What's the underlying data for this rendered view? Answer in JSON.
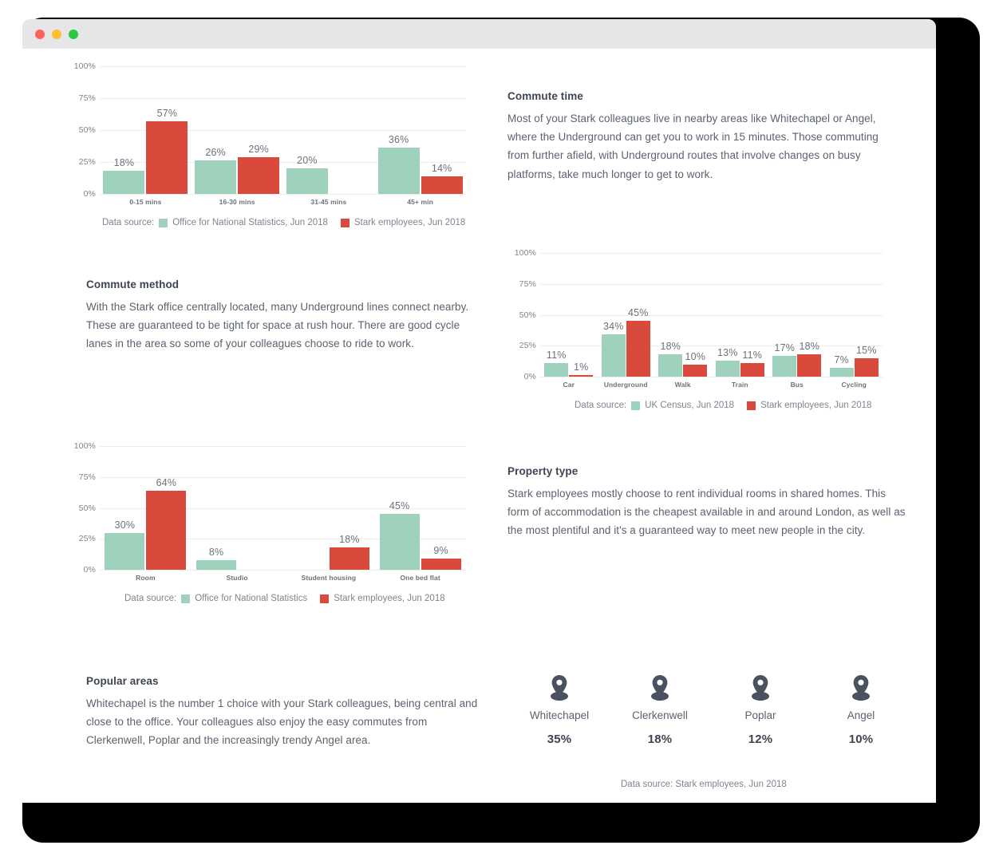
{
  "window": {
    "traffic_lights": [
      "close",
      "minimize",
      "maximize"
    ],
    "colors": {
      "close": "#ff6159",
      "minimize": "#ffbe2f",
      "maximize": "#2bc940"
    }
  },
  "theme": {
    "green": "#9ed1bb",
    "red": "#d9493c",
    "text": "#5b6270",
    "heading": "#3e4552",
    "muted": "#7d8590",
    "grid": "#eceded"
  },
  "sections": {
    "commute_time": {
      "title": "Commute time",
      "body": "Most of your Stark colleagues live in nearby areas like Whitechapel or Angel, where the Underground can get you to work in 15 minutes. Those commuting from further afield, with Underground routes that involve changes on busy platforms, take much longer to get to work."
    },
    "commute_method": {
      "title": "Commute method",
      "body": "With the Stark office centrally located, many Underground lines connect nearby. These are guaranteed to be tight for space at rush hour. There are good cycle lanes in the area so some of your colleagues choose to ride to work."
    },
    "property_type": {
      "title": "Property type",
      "body": "Stark employees mostly choose to rent individual rooms in shared homes. This form of accommodation is the cheapest available in and around London, as well as the most plentiful and it's a guaranteed way to meet new people in the city."
    },
    "popular_areas": {
      "title": "Popular areas",
      "body": "Whitechapel is the number 1 choice with your Stark colleagues, being central and close to the office. Your colleagues also enjoy the easy commutes from Clerkenwell, Poplar and the increasingly trendy Angel area."
    }
  },
  "legend_prefix": "Data source:",
  "pins": {
    "icon": "map-pin-icon",
    "items": [
      {
        "name": "Whitechapel",
        "value": "35%"
      },
      {
        "name": "Clerkenwell",
        "value": "18%"
      },
      {
        "name": "Poplar",
        "value": "12%"
      },
      {
        "name": "Angel",
        "value": "10%"
      }
    ],
    "source": "Data source: Stark employees, Jun 2018"
  },
  "chart_data": [
    {
      "id": "commute-time-chart",
      "type": "bar",
      "title": "",
      "xlabel": "",
      "ylabel": "",
      "ylim": [
        0,
        100
      ],
      "yticks": [
        "0%",
        "25%",
        "50%",
        "75%",
        "100%"
      ],
      "grid": true,
      "legend_position": "bottom",
      "categories": [
        "0-15 mins",
        "16-30 mins",
        "31-45 mins",
        "45+ min"
      ],
      "series": [
        {
          "name": "Office for National Statistics, Jun 2018",
          "color": "#9ed1bb",
          "values": [
            18,
            26,
            20,
            36
          ],
          "labels": [
            "18%",
            "26%",
            "20%",
            "36%"
          ]
        },
        {
          "name": "Stark employees, Jun 2018",
          "color": "#d9493c",
          "values": [
            57,
            29,
            0,
            14
          ],
          "labels": [
            "57%",
            "29%",
            "",
            "14%"
          ]
        }
      ]
    },
    {
      "id": "commute-method-chart",
      "type": "bar",
      "title": "",
      "xlabel": "",
      "ylabel": "",
      "ylim": [
        0,
        100
      ],
      "yticks": [
        "0%",
        "25%",
        "50%",
        "75%",
        "100%"
      ],
      "grid": true,
      "legend_position": "bottom",
      "categories": [
        "Car",
        "Underground",
        "Walk",
        "Train",
        "Bus",
        "Cycling"
      ],
      "series": [
        {
          "name": "UK Census, Jun 2018",
          "color": "#9ed1bb",
          "values": [
            11,
            34,
            18,
            13,
            17,
            7
          ],
          "labels": [
            "11%",
            "34%",
            "18%",
            "13%",
            "17%",
            "7%"
          ]
        },
        {
          "name": "Stark employees, Jun 2018",
          "color": "#d9493c",
          "values": [
            1,
            45,
            10,
            11,
            18,
            15
          ],
          "labels": [
            "1%",
            "45%",
            "10%",
            "11%",
            "18%",
            "15%"
          ]
        }
      ]
    },
    {
      "id": "property-type-chart",
      "type": "bar",
      "title": "",
      "xlabel": "",
      "ylabel": "",
      "ylim": [
        0,
        100
      ],
      "yticks": [
        "0%",
        "25%",
        "50%",
        "75%",
        "100%"
      ],
      "grid": true,
      "legend_position": "bottom",
      "categories": [
        "Room",
        "Studio",
        "Student housing",
        "One bed flat"
      ],
      "series": [
        {
          "name": "Office for National Statistics",
          "color": "#9ed1bb",
          "values": [
            30,
            8,
            0,
            45
          ],
          "labels": [
            "30%",
            "8%",
            "",
            "45%"
          ]
        },
        {
          "name": "Stark employees, Jun 2018",
          "color": "#d9493c",
          "values": [
            64,
            0,
            18,
            9
          ],
          "labels": [
            "64%",
            "",
            "18%",
            "9%"
          ]
        }
      ]
    }
  ]
}
